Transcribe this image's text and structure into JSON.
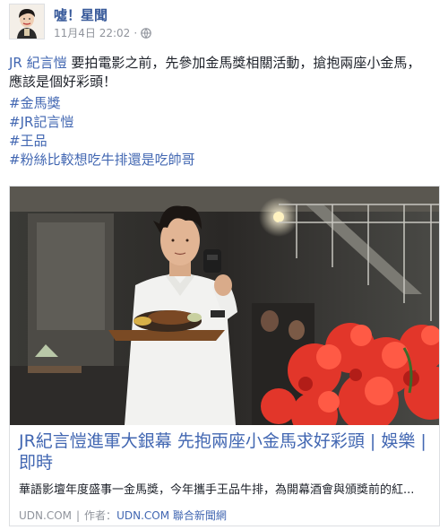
{
  "post": {
    "page_name": "噓！星聞",
    "date": "11月4日 22:02",
    "separator": "·",
    "privacy_icon": "globe-icon",
    "text_mention": "JR 紀言愷",
    "text_line1_rest": " 要拍電影之前，先參加金馬獎相關活動，搶抱兩座小金馬，",
    "text_line2": "應該是個好彩頭！",
    "hashtags": [
      "#金馬獎",
      "#JR記言愷",
      "#王品",
      "#粉絲比較想吃牛排還是吃帥哥"
    ]
  },
  "link_card": {
    "title": "JR紀言愷進軍大銀幕 先抱兩座小金馬求好彩頭 | 娛樂 | 即時",
    "description": "華語影壇年度盛事一金馬獎，今年攜手王品牛排，為開幕酒會與頒獎前的紅...",
    "source_domain": "UDN.COM",
    "source_sep": "|",
    "author_label": "作者：",
    "author_link": "UDN.COM 聯合新聞網"
  },
  "colors": {
    "link_blue": "#4267b2",
    "name_blue": "#365899",
    "meta_gray": "#90949c",
    "border": "#dddfe2"
  }
}
